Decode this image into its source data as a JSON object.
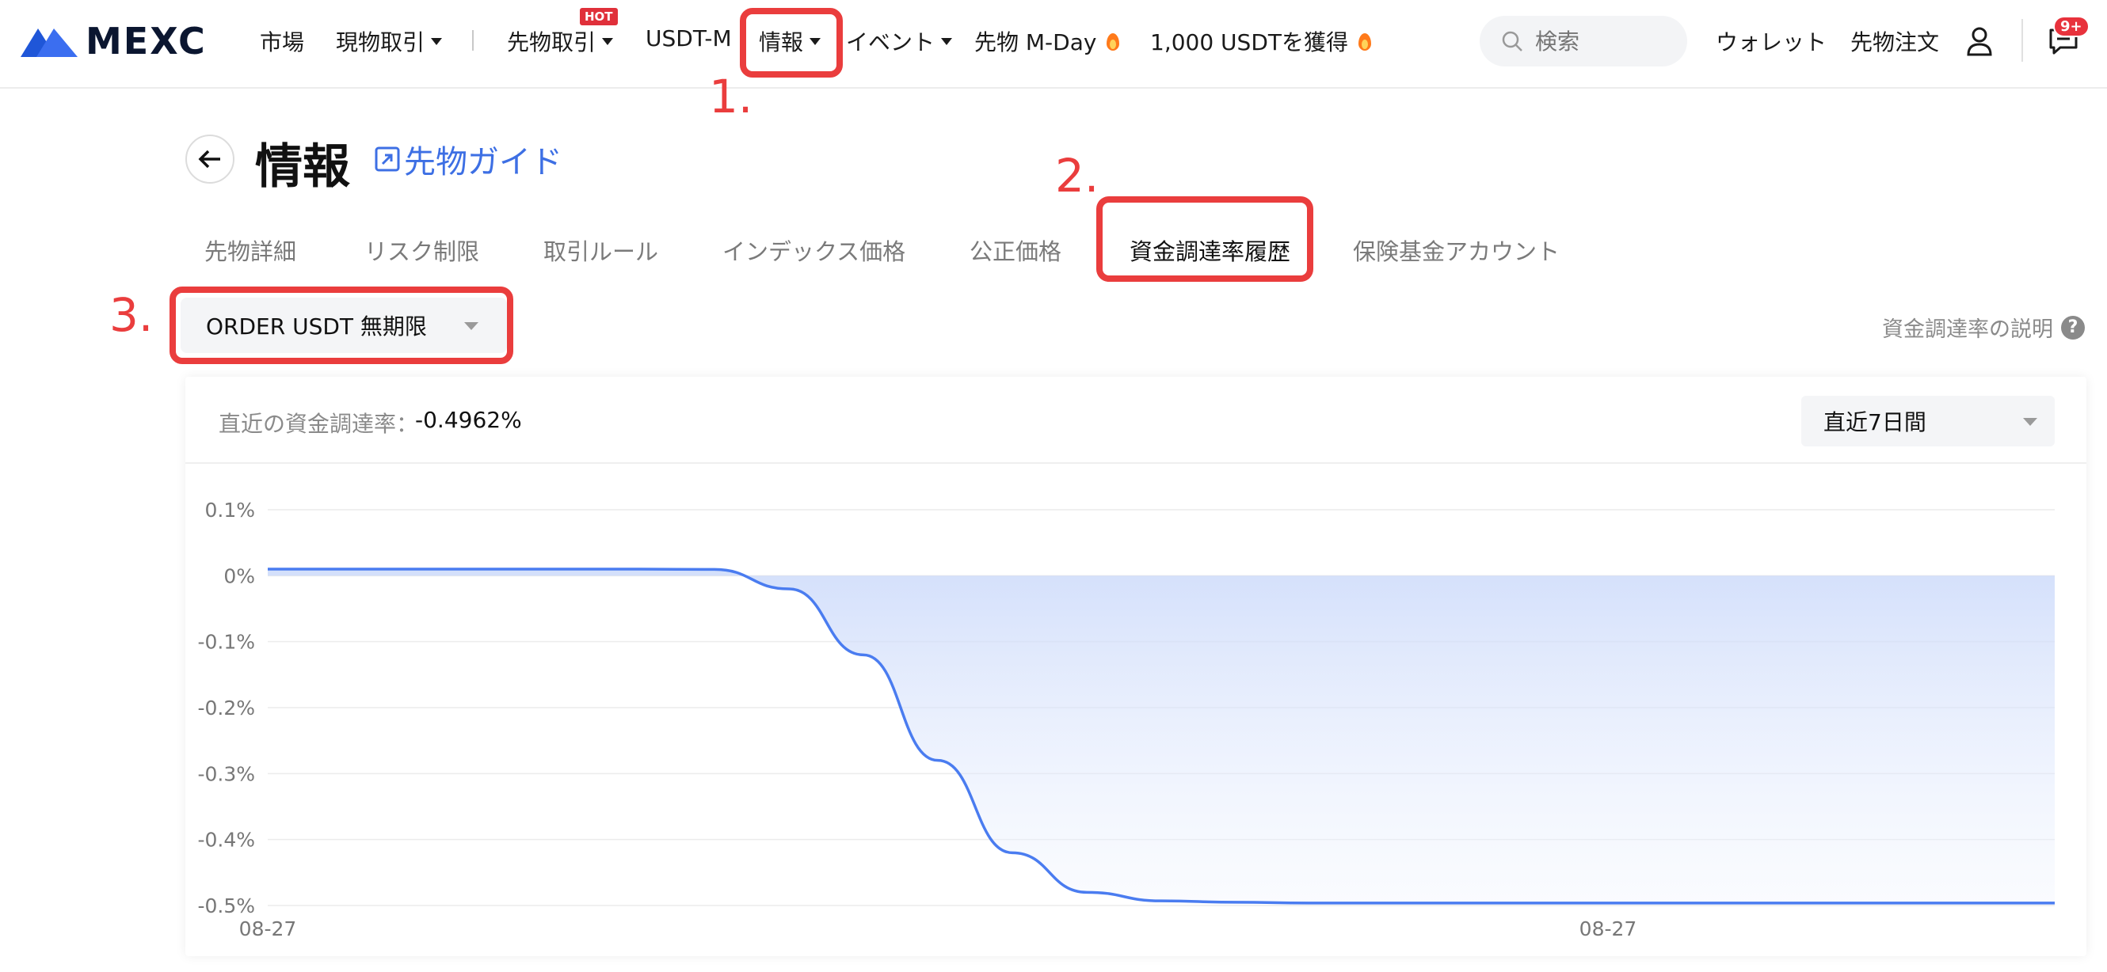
{
  "brand": {
    "name": "MEXC",
    "logo_color": "#3b6ef0"
  },
  "topnav": {
    "items": [
      {
        "label": "市場",
        "dropdown": false
      },
      {
        "label": "現物取引",
        "dropdown": true
      },
      {
        "label": "先物取引",
        "dropdown": true,
        "badge": "HOT"
      },
      {
        "label": "USDT-M",
        "dropdown": false
      },
      {
        "label": "情報",
        "dropdown": true
      },
      {
        "label": "イベント",
        "dropdown": true
      },
      {
        "label": "先物 M-Day",
        "dropdown": false,
        "icon": "fire-icon"
      },
      {
        "label": "1,000 USDTを獲得",
        "dropdown": false,
        "icon": "fire-icon"
      }
    ],
    "search_placeholder": "検索",
    "wallet": "ウォレット",
    "futures_orders": "先物注文",
    "notification_count": "9+"
  },
  "annotations": {
    "step1": "1.",
    "step2": "2.",
    "step3": "3.",
    "color": "#ea3d3d"
  },
  "page": {
    "title": "情報",
    "guide_link": "先物ガイド"
  },
  "tabs": [
    "先物詳細",
    "リスク制限",
    "取引ルール",
    "インデックス価格",
    "公正価格",
    "資金調達率履歴",
    "保険基金アカウント"
  ],
  "active_tab": "資金調達率履歴",
  "symbol_select": {
    "value": "ORDER USDT 無期限"
  },
  "explain_link": "資金調達率の説明",
  "card": {
    "latest_label": "直近の資金調達率：",
    "latest_value": "-0.4962%",
    "range_select": "直近7日間"
  },
  "chart_data": {
    "type": "area",
    "title": "",
    "xlabel": "",
    "ylabel": "",
    "ylim": [
      -0.5,
      0.1
    ],
    "y_ticks": [
      "0.1%",
      "0%",
      "-0.1%",
      "-0.2%",
      "-0.3%",
      "-0.4%",
      "-0.5%"
    ],
    "y_tick_values": [
      0.1,
      0,
      -0.1,
      -0.2,
      -0.3,
      -0.4,
      -0.5
    ],
    "x_tick_labels": [
      "08-27",
      "08-27"
    ],
    "series": [
      {
        "color": "#4a7cf0",
        "points": [
          0.01,
          0.01,
          0.01,
          0.01,
          0.01,
          0.01,
          0.0095,
          -0.02,
          -0.12,
          -0.28,
          -0.42,
          -0.48,
          -0.493,
          -0.495,
          -0.4962,
          -0.4962,
          -0.4962,
          -0.4962,
          -0.4962,
          -0.4962,
          -0.4962,
          -0.4962,
          -0.4962,
          -0.4962,
          -0.4962
        ]
      }
    ],
    "grid": true
  }
}
